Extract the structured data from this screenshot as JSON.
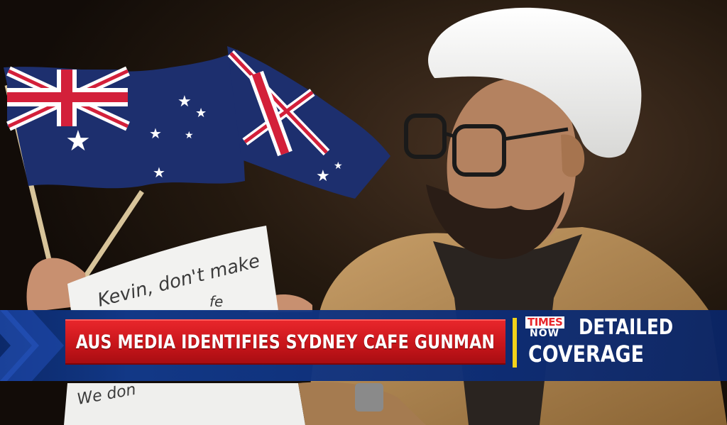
{
  "ticker": {
    "headline": "AUS MEDIA IDENTIFIES SYDNEY CAFE GUNMAN",
    "brand_top": "TIMES",
    "brand_bottom": "NOW",
    "coverage_line1": "DETAILED",
    "coverage_line2": "COVERAGE"
  },
  "sign": {
    "line1": "Kevin, don't make",
    "line2": "fe",
    "line3": "We don"
  },
  "colors": {
    "band": "#123a8c",
    "headline_bg": "#c8161b",
    "divider": "#f2d21a",
    "brand_red": "#e8262b"
  }
}
